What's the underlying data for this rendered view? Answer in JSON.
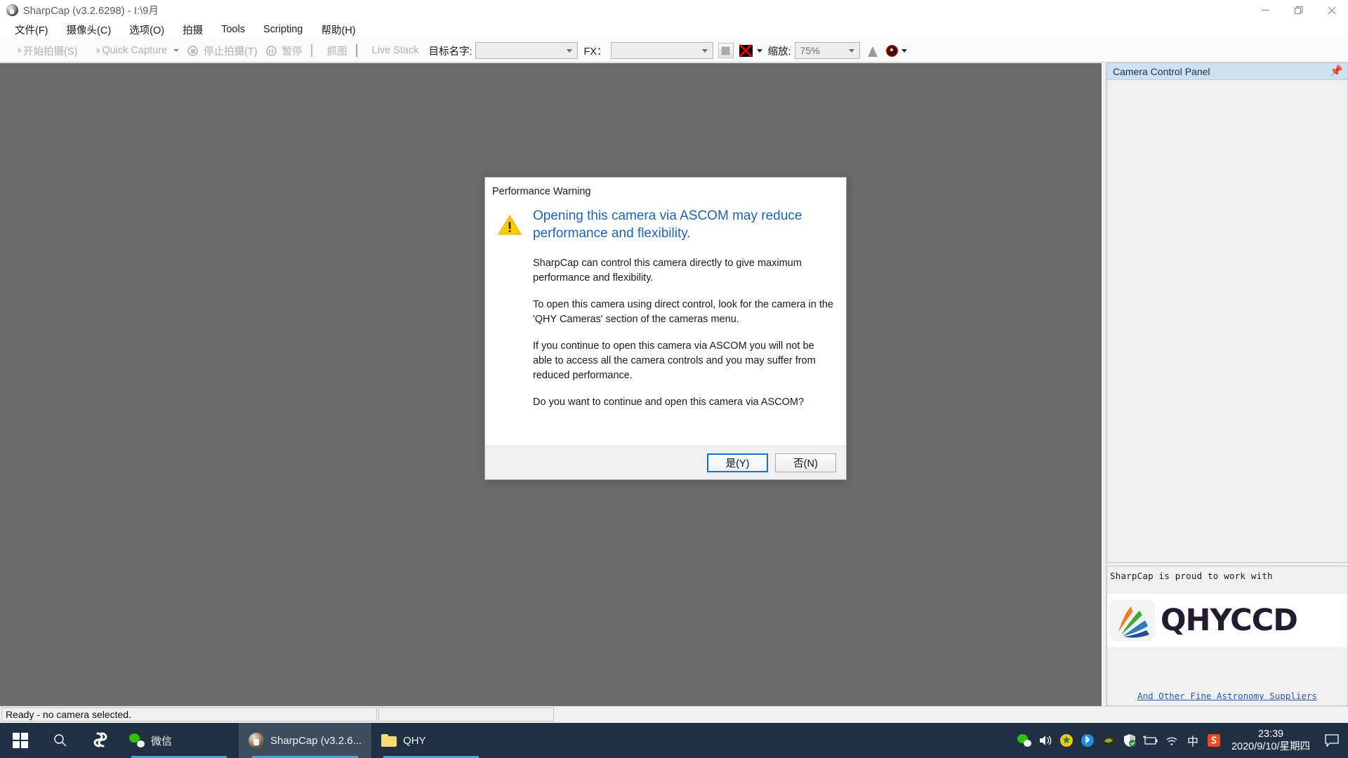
{
  "window": {
    "title": "SharpCap (v3.2.6298) - I:\\9月",
    "app_icon": "sharpcap-globe-icon",
    "controls": {
      "minimize": "minimize-icon",
      "maximize": "maximize-icon",
      "close": "close-icon"
    }
  },
  "menubar": {
    "items": [
      {
        "label": "文件(F)"
      },
      {
        "label": "摄像头(C)"
      },
      {
        "label": "选项(O)"
      },
      {
        "label": "拍摄"
      },
      {
        "label": "Tools"
      },
      {
        "label": "Scripting"
      },
      {
        "label": "帮助(H)"
      }
    ]
  },
  "toolbar": {
    "start_capture": "开始拍摄(S)",
    "quick_capture": "Quick Capture",
    "stop_capture": "停止拍摄(T)",
    "pause": "暂停",
    "snapshot": "抓图",
    "live_stack": "Live Stack",
    "target_name_label": "目标名字:",
    "target_name_value": "",
    "fx_label": "FX：",
    "fx_value": "",
    "zoom_label": "缩放:",
    "zoom_value": "75%"
  },
  "dock": {
    "header_title": "Camera Control Panel",
    "pin_icon": "pin-icon",
    "sponsor": {
      "title": "SharpCap is proud to work with",
      "logo_text": "QHYCCD",
      "logo_mark": "qhyccd-swoosh-icon",
      "link": "And Other Fine Astronomy Suppliers"
    }
  },
  "statusbar": {
    "message": "Ready - no camera selected.",
    "secondary": ""
  },
  "dialog": {
    "title": "Performance Warning",
    "warning_icon": "warning-triangle-icon",
    "heading": "Opening this camera via ASCOM may reduce performance and flexibility.",
    "paragraphs": [
      "SharpCap can control this camera directly to give maximum performance and flexibility.",
      "To open this camera using direct control, look for the camera in the 'QHY Cameras' section of the cameras menu.",
      "If you continue to open this camera via ASCOM you will not be able to access all the camera controls and you may suffer from reduced performance.",
      "Do you want to continue and open this camera via ASCOM?"
    ],
    "yes_button": "是(Y)",
    "no_button": "否(N)"
  },
  "taskbar": {
    "start_icon": "windows-start-icon",
    "search_icon": "search-icon",
    "cortana_icon": "cortana-icon",
    "items": [
      {
        "label": "微信",
        "icon": "wechat-icon",
        "active": false
      },
      {
        "label": "SharpCap (v3.2.6...",
        "icon": "sharpcap-icon",
        "active": true
      },
      {
        "label": "QHY",
        "icon": "folder-icon",
        "active": false
      }
    ],
    "tray": [
      "wechat-tray-icon",
      "volume-icon",
      "security-shield-icon",
      "bluetooth-icon",
      "nvidia-icon",
      "defender-icon",
      "battery-icon",
      "wifi-icon",
      "ime-chinese-icon",
      "sogou-icon"
    ],
    "ime_label": "中",
    "clock_time": "23:39",
    "clock_date": "2020/9/10/星期四",
    "notification_icon": "notification-icon"
  },
  "colors": {
    "preview_background": "#6b6b6b",
    "taskbar_background": "#1f3044",
    "dialog_heading": "#1f62b0",
    "dock_header": "#cde1f0",
    "accent_button_border": "#1572cf",
    "warning_yellow": "#ffcc00"
  }
}
